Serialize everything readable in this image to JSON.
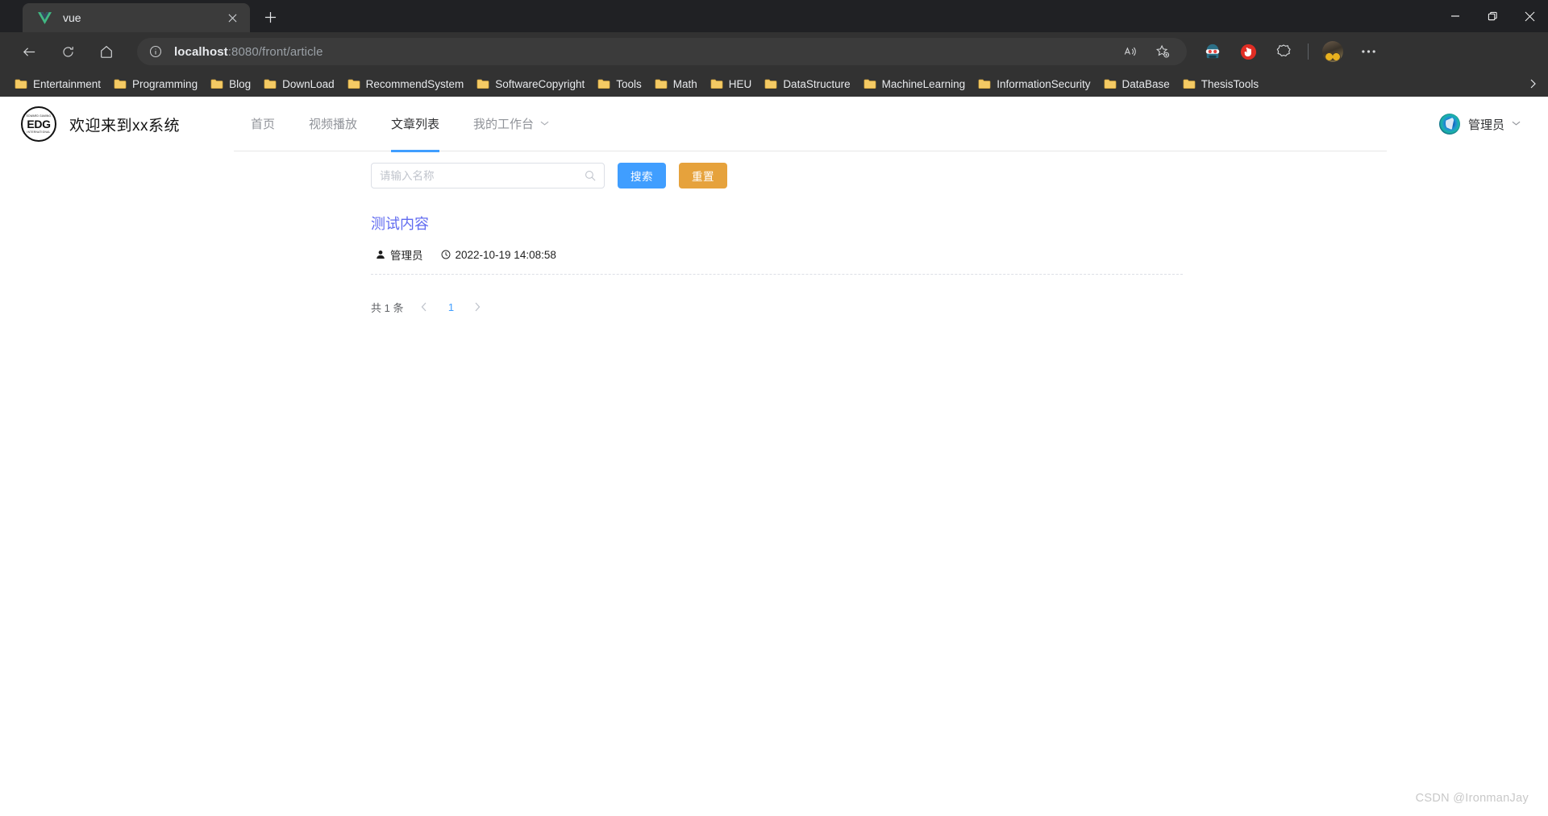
{
  "browser": {
    "tab": {
      "title": "vue",
      "favicon": "vue-logo-icon",
      "close_icon": "close-icon"
    },
    "new_tab_label": "+",
    "window_controls": {
      "minimize": "minimize-icon",
      "maximize": "restore-icon",
      "close": "close-icon"
    },
    "nav": {
      "back_icon": "back-arrow-icon",
      "reload_icon": "reload-icon",
      "home_icon": "home-icon"
    },
    "omnibox": {
      "info_icon": "site-info-icon",
      "host": "localhost",
      "path": ":8080/front/article",
      "read_aloud_icon": "read-aloud-icon",
      "favorite_icon": "add-favorite-icon"
    },
    "toolbar_icons": [
      {
        "name": "extension-character-icon"
      },
      {
        "name": "adblock-stop-icon"
      },
      {
        "name": "extension-puzzle-icon"
      }
    ],
    "profile": {
      "name": "profile-avatar"
    },
    "settings_icon": "more-options-icon",
    "bookmarks": [
      {
        "label": "Entertainment"
      },
      {
        "label": "Programming"
      },
      {
        "label": "Blog"
      },
      {
        "label": "DownLoad"
      },
      {
        "label": "RecommendSystem"
      },
      {
        "label": "SoftwareCopyright"
      },
      {
        "label": "Tools"
      },
      {
        "label": "Math"
      },
      {
        "label": "HEU"
      },
      {
        "label": "DataStructure"
      },
      {
        "label": "MachineLearning"
      },
      {
        "label": "InformationSecurity"
      },
      {
        "label": "DataBase"
      },
      {
        "label": "ThesisTools"
      }
    ],
    "bookmarks_overflow_icon": "chevron-right-icon"
  },
  "site": {
    "logo": {
      "top_text": "EDWARD GAMING",
      "main_text": "EDG",
      "bottom_text": "INTERNATIONAL"
    },
    "title": "欢迎来到xx系统",
    "nav": [
      {
        "label": "首页",
        "active": false
      },
      {
        "label": "视频播放",
        "active": false
      },
      {
        "label": "文章列表",
        "active": true
      },
      {
        "label": "我的工作台",
        "active": false,
        "caret": "▾"
      }
    ],
    "user": {
      "name": "管理员",
      "caret": "▾",
      "avatar": "user-avatar"
    }
  },
  "search": {
    "placeholder": "请输入名称",
    "value": "",
    "icon": "search-icon",
    "search_button": "搜索",
    "reset_button": "重置"
  },
  "articles": [
    {
      "title": "测试内容",
      "author": "管理员",
      "author_icon": "user-icon",
      "time": "2022-10-19 14:08:58",
      "time_icon": "clock-icon"
    }
  ],
  "pagination": {
    "total_text": "共 1 条",
    "prev_icon": "chevron-left-icon",
    "next_icon": "chevron-right-icon",
    "pages": [
      "1"
    ],
    "current": "1"
  },
  "watermark": "CSDN @IronmanJay",
  "colors": {
    "accent_blue": "#409eff",
    "warning_orange": "#e6a23c",
    "link_purple": "#606bf0",
    "chrome_dark": "#323232",
    "tabstrip_dark": "#202124"
  }
}
